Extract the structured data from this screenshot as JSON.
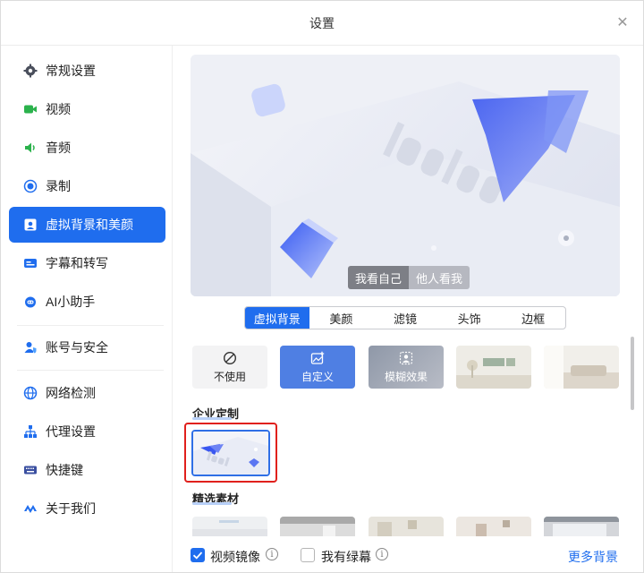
{
  "window": {
    "title": "设置"
  },
  "sidebar": {
    "items": [
      {
        "label": "常规设置",
        "icon": "gear-icon"
      },
      {
        "label": "视频",
        "icon": "video-camera-icon"
      },
      {
        "label": "音频",
        "icon": "speaker-icon"
      },
      {
        "label": "录制",
        "icon": "record-icon"
      },
      {
        "label": "虚拟背景和美颜",
        "icon": "portrait-icon",
        "active": true
      },
      {
        "label": "字幕和转写",
        "icon": "subtitle-icon"
      },
      {
        "label": "AI小助手",
        "icon": "robot-icon"
      },
      {
        "label": "账号与安全",
        "icon": "user-shield-icon"
      },
      {
        "label": "网络检测",
        "icon": "globe-icon"
      },
      {
        "label": "代理设置",
        "icon": "network-tree-icon"
      },
      {
        "label": "快捷键",
        "icon": "keyboard-icon"
      },
      {
        "label": "关于我们",
        "icon": "logo-icon"
      }
    ]
  },
  "preview": {
    "toggle": {
      "self_view": "我看自己",
      "others_view": "他人看我"
    }
  },
  "tabs": [
    "虚拟背景",
    "美颜",
    "滤镜",
    "头饰",
    "边框"
  ],
  "backgrounds": {
    "none_label": "不使用",
    "custom_label": "自定义",
    "blur_label": "模糊效果"
  },
  "sections": {
    "enterprise": "企业定制",
    "featured": "精选素材"
  },
  "footer": {
    "mirror_label": "视频镜像",
    "green_screen_label": "我有绿幕",
    "more_label": "更多背景",
    "mirror_checked": true,
    "green_screen_checked": false
  },
  "colors": {
    "accent": "#1f6dee",
    "highlight": "#e0201c"
  }
}
